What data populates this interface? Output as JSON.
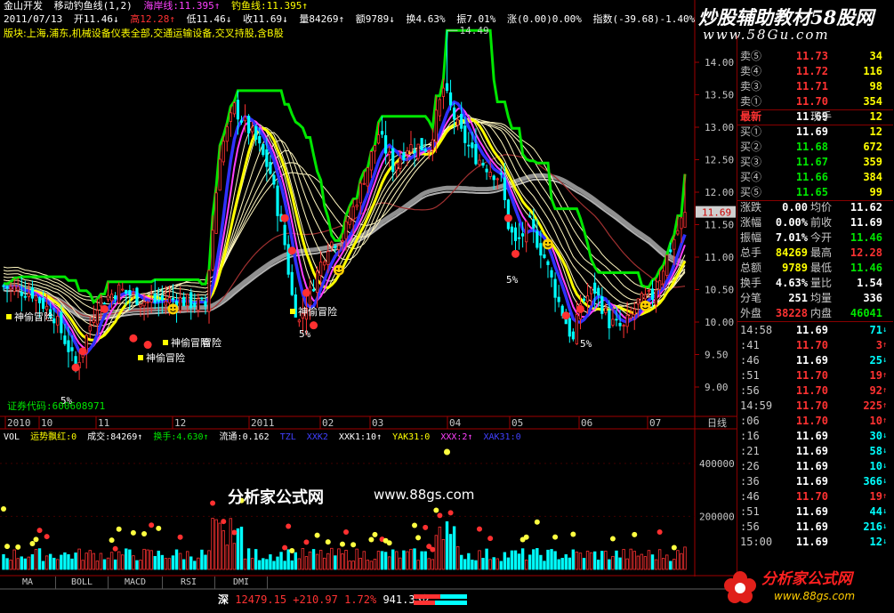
{
  "header": {
    "line1": [
      "金山开发",
      "移动钓鱼线(1,2)",
      "海岸线:11.395↑",
      "钓鱼线:11.395↑"
    ],
    "line2": [
      "2011/07/13",
      "开11.46↓",
      "高12.28↑",
      "低11.46↓",
      "收11.69↓",
      "量84269↑",
      "额9789↓",
      "换4.63%",
      "振7.01%",
      "涨(0.00)0.00%",
      "指数(-39.68)-1.40%"
    ],
    "line3": "版块:上海,浦东,机械设备仪表全部,交通运输设备,交叉持股,含B股"
  },
  "watermark": {
    "title": "炒股辅助教材58股网",
    "url": "www.58Gu.com",
    "mid_brand": "分析家公式网",
    "mid_url": "www.88gs.com",
    "logo_brand": "分析家公式网",
    "logo_url": "www.88gs.com"
  },
  "price_axis": [
    "14.00",
    "13.50",
    "13.00",
    "12.50",
    "12.00",
    "11.50",
    "11.00",
    "10.50",
    "10.00",
    "9.50",
    "9.00"
  ],
  "current_price_tag": "11.69",
  "high_label": "14.49",
  "stock_code_label": "证券代码:600608971",
  "date_axis": [
    "2010",
    "10",
    "11",
    "12",
    "2011",
    "02",
    "03",
    "04",
    "05",
    "06",
    "07"
  ],
  "period_label": "日线",
  "vol_header": [
    "VOL",
    "运势飘红:0",
    "成交:84269↑",
    "换手:4.630↑",
    "流通:0.162",
    "TZL",
    "XXK2",
    "XXK1:10↑",
    "YAK31:0",
    "XXX:2↑",
    "XAK31:0"
  ],
  "vol_axis": [
    "400000",
    "200000"
  ],
  "chart_annotations": [
    "神偷冒险",
    "神偷冒险",
    "神偷冒险",
    "神偷冒险",
    "冒险",
    "5%",
    "5%",
    "5%",
    "5%"
  ],
  "bottom_tabs": [
    "MA",
    "BOLL",
    "MACD",
    "RSI",
    "DMI"
  ],
  "index_bar": {
    "name": "深",
    "value": "12479.15",
    "change": "+210.97",
    "pct": "1.72%",
    "amount": "941.35亿"
  },
  "quote": {
    "sells": [
      {
        "label": "卖⑤",
        "price": "11.73",
        "vol": "34"
      },
      {
        "label": "卖④",
        "price": "11.72",
        "vol": "116"
      },
      {
        "label": "卖③",
        "price": "11.71",
        "vol": "98"
      },
      {
        "label": "卖①",
        "price": "11.70",
        "vol": "354"
      }
    ],
    "latest": {
      "label": "最新",
      "price": "11.69",
      "hand_label": "现手",
      "hand": "12"
    },
    "buys": [
      {
        "label": "买①",
        "price": "11.69",
        "vol": "12"
      },
      {
        "label": "买②",
        "price": "11.68",
        "vol": "672"
      },
      {
        "label": "买③",
        "price": "11.67",
        "vol": "359"
      },
      {
        "label": "买④",
        "price": "11.66",
        "vol": "384"
      },
      {
        "label": "买⑤",
        "price": "11.65",
        "vol": "99"
      }
    ],
    "stats": [
      {
        "l1": "涨跌",
        "v1": "0.00",
        "l2": "均价",
        "v2": "11.62"
      },
      {
        "l1": "涨幅",
        "v1": "0.00%",
        "l2": "前收",
        "v2": "11.69"
      },
      {
        "l1": "振幅",
        "v1": "7.01%",
        "l2": "今开",
        "v2": "11.46"
      },
      {
        "l1": "总手",
        "v1": "84269",
        "l2": "最高",
        "v2": "12.28"
      },
      {
        "l1": "总额",
        "v1": "9789",
        "l2": "最低",
        "v2": "11.46"
      },
      {
        "l1": "换手",
        "v1": "4.63%",
        "l2": "量比",
        "v2": "1.54"
      },
      {
        "l1": "分笔",
        "v1": "251",
        "l2": "均量",
        "v2": "336"
      },
      {
        "l1": "外盘",
        "v1": "38228",
        "l2": "内盘",
        "v2": "46041"
      }
    ],
    "ticks": [
      {
        "t": "14:58",
        "p": "11.69",
        "v": "71",
        "a": "↓"
      },
      {
        "t": ":41",
        "p": "11.70",
        "v": "3",
        "a": "↑"
      },
      {
        "t": ":46",
        "p": "11.69",
        "v": "25",
        "a": "↓"
      },
      {
        "t": ":51",
        "p": "11.70",
        "v": "19",
        "a": "↑"
      },
      {
        "t": ":56",
        "p": "11.70",
        "v": "92",
        "a": "↑"
      },
      {
        "t": "14:59",
        "p": "11.70",
        "v": "225",
        "a": "↑"
      },
      {
        "t": ":06",
        "p": "11.70",
        "v": "10",
        "a": "↑"
      },
      {
        "t": ":16",
        "p": "11.69",
        "v": "30",
        "a": "↓"
      },
      {
        "t": ":21",
        "p": "11.69",
        "v": "58",
        "a": "↓"
      },
      {
        "t": ":26",
        "p": "11.69",
        "v": "10",
        "a": "↓"
      },
      {
        "t": ":36",
        "p": "11.69",
        "v": "366",
        "a": "↓"
      },
      {
        "t": ":46",
        "p": "11.70",
        "v": "19",
        "a": "↑"
      },
      {
        "t": ":51",
        "p": "11.69",
        "v": "44",
        "a": "↓"
      },
      {
        "t": ":56",
        "p": "11.69",
        "v": "216",
        "a": "↓"
      },
      {
        "t": "15:00",
        "p": "11.69",
        "v": "12",
        "a": "↓"
      }
    ]
  },
  "colors": {
    "up": "#ff3232",
    "down": "#00ffff",
    "grid": "#800000",
    "yellow": "#ffff00",
    "green": "#00e600",
    "blue": "#0000ff",
    "magenta": "#ff00ff"
  }
}
